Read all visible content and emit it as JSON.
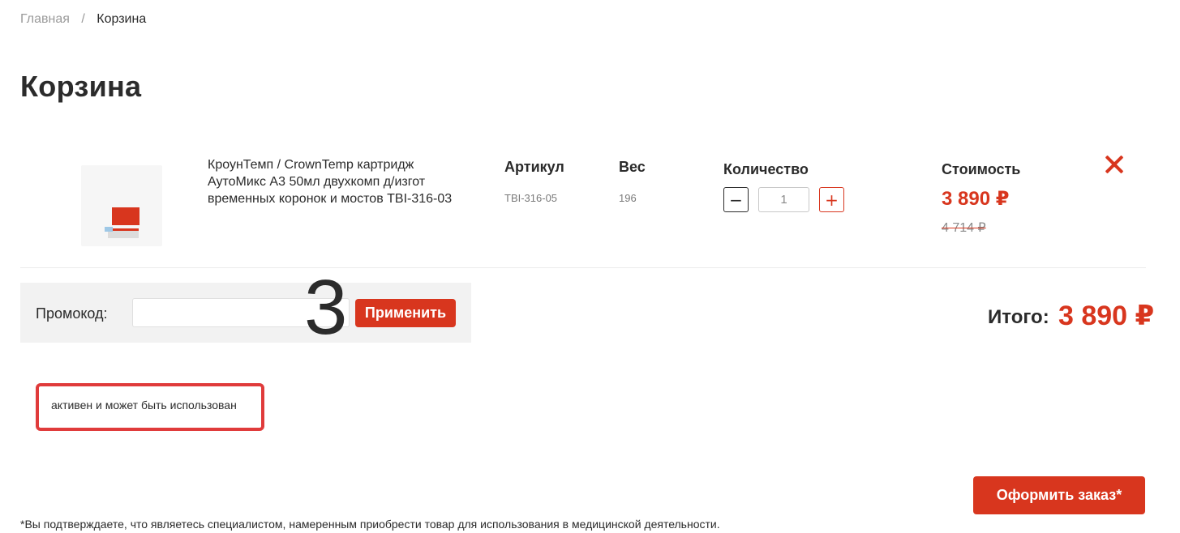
{
  "breadcrumb": {
    "home": "Главная",
    "separator": "/",
    "current": "Корзина"
  },
  "page_title": "Корзина",
  "cart": {
    "item": {
      "name": "КроунТемп / CrownTemp картридж АутоМикс А3 50мл двухкомп д/изгот временных коронок и мостов TBI-316-03",
      "sku_label": "Артикул",
      "sku": "TBI-316-05",
      "weight_label": "Вес",
      "weight": "196",
      "quantity_label": "Количество",
      "quantity": "1",
      "qty_minus": "−",
      "qty_plus": "+",
      "cost_label": "Стоимость",
      "price": "3 890 ₽",
      "old_price": "4 714 ₽"
    }
  },
  "promo": {
    "label": "Промокод:",
    "value": "",
    "apply_label": "Применить",
    "status_text": "активен и может быть использован"
  },
  "step_number": "3",
  "total": {
    "label": "Итого:",
    "value": "3 890 ₽"
  },
  "checkout_label": "Оформить заказ*",
  "disclaimer": "*Вы подтверждаете, что являетесь специалистом, намеренным приобрести товар для использования в медицинской деятельности.",
  "colors": {
    "accent": "#d8361e",
    "text": "#2b2b2b",
    "muted": "#9a9a9a",
    "panel": "#f2f2f2"
  }
}
